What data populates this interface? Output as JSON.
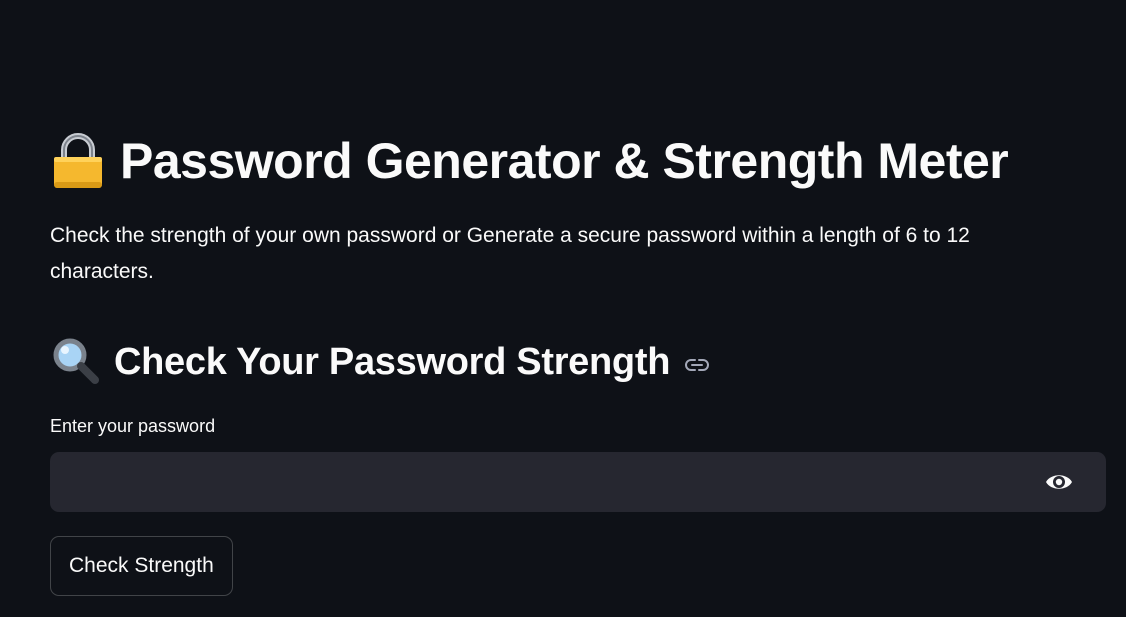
{
  "header": {
    "title": "Password Generator & Strength Meter",
    "title_icon": "lock-icon",
    "description": "Check the strength of your own password or Generate a secure password within a length of 6 to 12 characters."
  },
  "check_section": {
    "heading": "Check Your Password Strength",
    "heading_icon": "magnifying-glass-icon",
    "anchor_icon": "link-icon",
    "password_field": {
      "label": "Enter your password",
      "value": "",
      "placeholder": "",
      "toggle_icon": "eye-icon"
    },
    "check_button_label": "Check Strength"
  },
  "colors": {
    "background": "#0e1117",
    "input_background": "#262730",
    "text": "#fafafa",
    "lock_body": "#f5b82e"
  }
}
